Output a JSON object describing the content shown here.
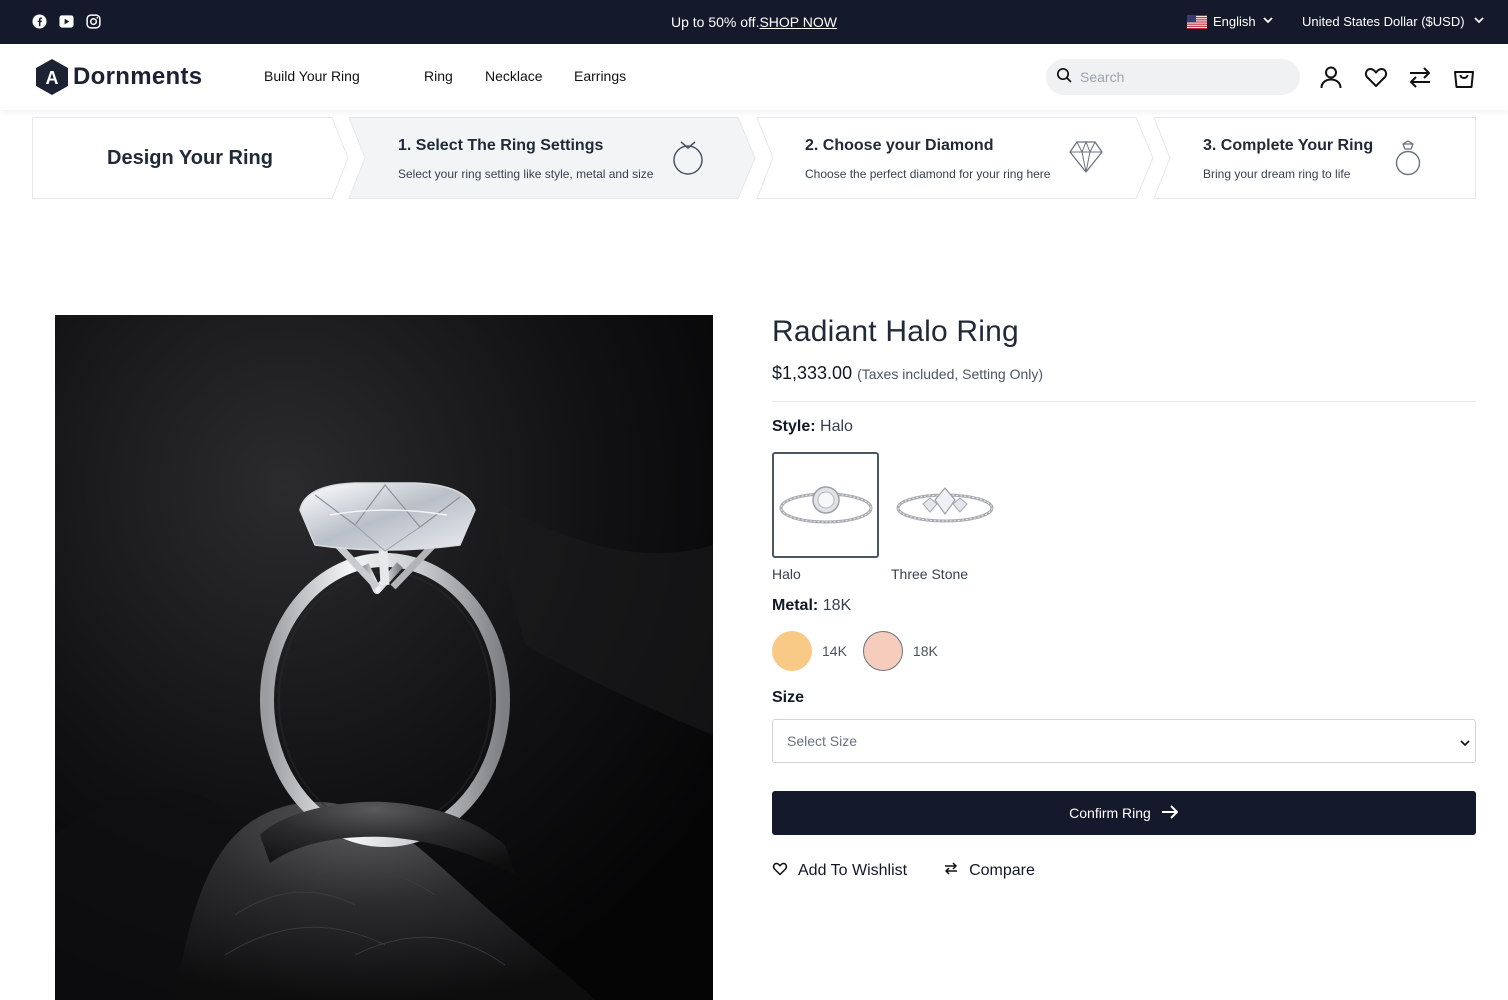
{
  "topbar": {
    "social": [
      "facebook-icon",
      "youtube-icon",
      "instagram-icon"
    ],
    "promo_text": "Up to 50% off.",
    "promo_link": "SHOP NOW",
    "language": "English",
    "currency": "United States Dollar ($USD)"
  },
  "header": {
    "logo_letter": "A",
    "logo_text": "Dornments",
    "nav": [
      "Build Your Ring",
      "Ring",
      "Necklace",
      "Earrings"
    ],
    "search_placeholder": "Search",
    "icons": [
      "account-icon",
      "wishlist-icon",
      "compare-icon",
      "cart-icon"
    ]
  },
  "steps": {
    "design_title": "Design Your Ring",
    "items": [
      {
        "title": "1. Select The Ring Settings",
        "subtitle": "Select your ring setting like style, metal and size",
        "icon": "ring-icon",
        "active": true
      },
      {
        "title": "2. Choose your Diamond",
        "subtitle": "Choose the perfect diamond for your ring here",
        "icon": "diamond-icon",
        "active": false
      },
      {
        "title": "3. Complete Your Ring",
        "subtitle": "Bring your dream ring to life",
        "icon": "complete-ring-icon",
        "active": false
      }
    ]
  },
  "product": {
    "title": "Radiant Halo Ring",
    "price": "$1,333.00",
    "price_note": "(Taxes included, Setting Only)",
    "style_label": "Style:",
    "style_value": "Halo",
    "styles": [
      {
        "label": "Halo",
        "selected": true
      },
      {
        "label": "Three Stone",
        "selected": false
      }
    ],
    "metal_label": "Metal:",
    "metal_value": "18K",
    "metals": [
      {
        "label": "14K",
        "color": "#f8ca86"
      },
      {
        "label": "18K",
        "color": "#f6cdbc"
      }
    ],
    "size_label": "Size",
    "size_placeholder": "Select Size",
    "confirm_label": "Confirm Ring",
    "wishlist_label": "Add To Wishlist",
    "compare_label": "Compare"
  },
  "colors": {
    "dark": "#141a2b",
    "active_step": "#f3f4f6"
  }
}
